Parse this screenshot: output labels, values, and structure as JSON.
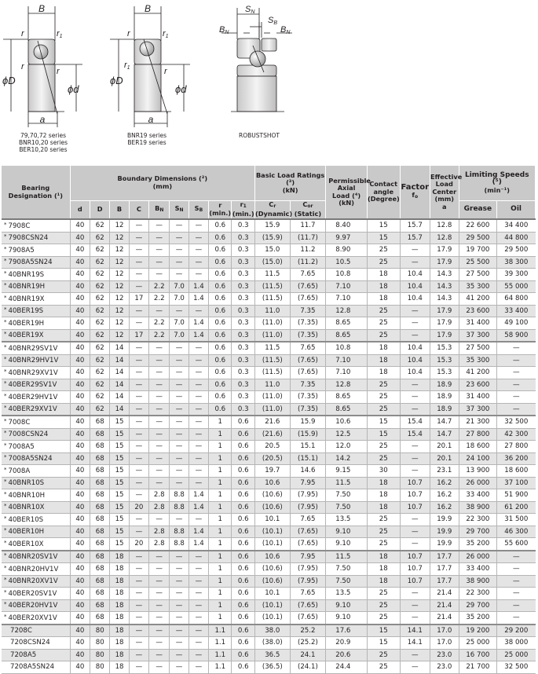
{
  "diagrams": {
    "captions": [
      [
        "79,70,72 series",
        "BNR10,20 series",
        "BER10,20 series"
      ],
      [
        "BNR19 series",
        "BER19 series"
      ],
      [
        "ROBUSTSHOT"
      ]
    ],
    "labels": {
      "B": "B",
      "r": "r",
      "r1": "r",
      "phiD": "ϕD",
      "phid": "ϕd",
      "a": "a",
      "SN": "S",
      "SB": "S",
      "BN": "B",
      "sub_N": "N",
      "sub_B": "B",
      "sub_1": "1"
    }
  },
  "table": {
    "headers": {
      "designation": "Bearing Designation (¹)",
      "boundary": "Boundary Dimensions (²)",
      "boundary_unit": "(mm)",
      "load_ratings": "Basic Load Ratings (³)",
      "load_ratings_unit": "(kN)",
      "permissible": "Permissible Axial Load (⁴)",
      "permissible_unit": "(kN)",
      "contact": "Contact angle",
      "contact_unit": "(Degree)",
      "factor": "Factor",
      "factor_sym": "f",
      "factor_sub": "o",
      "eff": "Effective Load Center",
      "eff_unit": "(mm)",
      "eff_sym": "a",
      "limiting": "Limiting Speeds (⁵)",
      "limiting_unit": "(min⁻¹)",
      "d": "d",
      "D": "D",
      "B": "B",
      "C": "C",
      "BN": "B",
      "SN": "S",
      "SB": "S",
      "N": "N",
      "Bsub": "B",
      "r": "r",
      "r1": "r",
      "r1_sub": "1",
      "min": "(min.)",
      "Cr": "C",
      "Cr_sub": "r",
      "Cr_note": "(Dynamic)",
      "Cor": "C",
      "Cor_sub": "or",
      "Cor_note": "(Static)",
      "grease": "Grease",
      "oil": "Oil"
    },
    "rows": [
      {
        "star": true,
        "des": "7908C",
        "v": [
          "40",
          "62",
          "12",
          "—",
          "—",
          "—",
          "—",
          "0.6",
          "0.3",
          "15.9",
          "11.7",
          "8.40",
          "15",
          "15.7",
          "12.8",
          "22 600",
          "34 400"
        ]
      },
      {
        "star": true,
        "des": "7908CSN24",
        "v": [
          "40",
          "62",
          "12",
          "—",
          "—",
          "—",
          "—",
          "0.6",
          "0.3",
          "(15.9)",
          "(11.7)",
          "9.97",
          "15",
          "15.7",
          "12.8",
          "29 500",
          "44 800"
        ]
      },
      {
        "star": true,
        "des": "7908A5",
        "v": [
          "40",
          "62",
          "12",
          "—",
          "—",
          "—",
          "—",
          "0.6",
          "0.3",
          "15.0",
          "11.2",
          "8.90",
          "25",
          "—",
          "17.9",
          "19 700",
          "29 500"
        ]
      },
      {
        "star": true,
        "des": "7908A5SN24",
        "v": [
          "40",
          "62",
          "12",
          "—",
          "—",
          "—",
          "—",
          "0.6",
          "0.3",
          "(15.0)",
          "(11.2)",
          "10.5",
          "25",
          "—",
          "17.9",
          "25 500",
          "38 300"
        ]
      },
      {
        "star": true,
        "des": "40BNR19S",
        "v": [
          "40",
          "62",
          "12",
          "—",
          "—",
          "—",
          "—",
          "0.6",
          "0.3",
          "11.5",
          "7.65",
          "10.8",
          "18",
          "10.4",
          "14.3",
          "27 500",
          "39 300"
        ]
      },
      {
        "star": true,
        "des": "40BNR19H",
        "v": [
          "40",
          "62",
          "12",
          "—",
          "2.2",
          "7.0",
          "1.4",
          "0.6",
          "0.3",
          "(11.5)",
          "(7.65)",
          "7.10",
          "18",
          "10.4",
          "14.3",
          "35 300",
          "55 000"
        ]
      },
      {
        "star": true,
        "des": "40BNR19X",
        "v": [
          "40",
          "62",
          "12",
          "17",
          "2.2",
          "7.0",
          "1.4",
          "0.6",
          "0.3",
          "(11.5)",
          "(7.65)",
          "7.10",
          "18",
          "10.4",
          "14.3",
          "41 200",
          "64 800"
        ]
      },
      {
        "star": true,
        "des": "40BER19S",
        "v": [
          "40",
          "62",
          "12",
          "—",
          "—",
          "—",
          "—",
          "0.6",
          "0.3",
          "11.0",
          "7.35",
          "12.8",
          "25",
          "—",
          "17.9",
          "23 600",
          "33 400"
        ]
      },
      {
        "star": true,
        "des": "40BER19H",
        "v": [
          "40",
          "62",
          "12",
          "—",
          "2.2",
          "7.0",
          "1.4",
          "0.6",
          "0.3",
          "(11.0)",
          "(7.35)",
          "8.65",
          "25",
          "—",
          "17.9",
          "31 400",
          "49 100"
        ]
      },
      {
        "star": true,
        "des": "40BER19X",
        "v": [
          "40",
          "62",
          "12",
          "17",
          "2.2",
          "7.0",
          "1.4",
          "0.6",
          "0.3",
          "(11.0)",
          "(7.35)",
          "8.65",
          "25",
          "—",
          "17.9",
          "37 300",
          "58 900"
        ]
      },
      {
        "star": true,
        "des": "40BNR29SV1V",
        "group": true,
        "v": [
          "40",
          "62",
          "14",
          "—",
          "—",
          "—",
          "—",
          "0.6",
          "0.3",
          "11.5",
          "7.65",
          "10.8",
          "18",
          "10.4",
          "15.3",
          "27 500",
          "—"
        ]
      },
      {
        "star": true,
        "des": "40BNR29HV1V",
        "v": [
          "40",
          "62",
          "14",
          "—",
          "—",
          "—",
          "—",
          "0.6",
          "0.3",
          "(11.5)",
          "(7.65)",
          "7.10",
          "18",
          "10.4",
          "15.3",
          "35 300",
          "—"
        ]
      },
      {
        "star": true,
        "des": "40BNR29XV1V",
        "v": [
          "40",
          "62",
          "14",
          "—",
          "—",
          "—",
          "—",
          "0.6",
          "0.3",
          "(11.5)",
          "(7.65)",
          "7.10",
          "18",
          "10.4",
          "15.3",
          "41 200",
          "—"
        ]
      },
      {
        "star": true,
        "des": "40BER29SV1V",
        "v": [
          "40",
          "62",
          "14",
          "—",
          "—",
          "—",
          "—",
          "0.6",
          "0.3",
          "11.0",
          "7.35",
          "12.8",
          "25",
          "—",
          "18.9",
          "23 600",
          "—"
        ]
      },
      {
        "star": true,
        "des": "40BER29HV1V",
        "v": [
          "40",
          "62",
          "14",
          "—",
          "—",
          "—",
          "—",
          "0.6",
          "0.3",
          "(11.0)",
          "(7.35)",
          "8.65",
          "25",
          "—",
          "18.9",
          "31 400",
          "—"
        ]
      },
      {
        "star": true,
        "des": "40BER29XV1V",
        "v": [
          "40",
          "62",
          "14",
          "—",
          "—",
          "—",
          "—",
          "0.6",
          "0.3",
          "(11.0)",
          "(7.35)",
          "8.65",
          "25",
          "—",
          "18.9",
          "37 300",
          "—"
        ]
      },
      {
        "star": true,
        "des": "7008C",
        "group": true,
        "v": [
          "40",
          "68",
          "15",
          "—",
          "—",
          "—",
          "—",
          "1",
          "0.6",
          "21.6",
          "15.9",
          "10.6",
          "15",
          "15.4",
          "14.7",
          "21 300",
          "32 500"
        ]
      },
      {
        "star": true,
        "des": "7008CSN24",
        "v": [
          "40",
          "68",
          "15",
          "—",
          "—",
          "—",
          "—",
          "1",
          "0.6",
          "(21.6)",
          "(15.9)",
          "12.5",
          "15",
          "15.4",
          "14.7",
          "27 800",
          "42 300"
        ]
      },
      {
        "star": true,
        "des": "7008A5",
        "v": [
          "40",
          "68",
          "15",
          "—",
          "—",
          "—",
          "—",
          "1",
          "0.6",
          "20.5",
          "15.1",
          "12.0",
          "25",
          "—",
          "20.1",
          "18 600",
          "27 800"
        ]
      },
      {
        "star": true,
        "des": "7008A5SN24",
        "v": [
          "40",
          "68",
          "15",
          "—",
          "—",
          "—",
          "—",
          "1",
          "0.6",
          "(20.5)",
          "(15.1)",
          "14.2",
          "25",
          "—",
          "20.1",
          "24 100",
          "36 200"
        ]
      },
      {
        "star": true,
        "des": "7008A",
        "v": [
          "40",
          "68",
          "15",
          "—",
          "—",
          "—",
          "—",
          "1",
          "0.6",
          "19.7",
          "14.6",
          "9.15",
          "30",
          "—",
          "23.1",
          "13 900",
          "18 600"
        ]
      },
      {
        "star": true,
        "des": "40BNR10S",
        "v": [
          "40",
          "68",
          "15",
          "—",
          "—",
          "—",
          "—",
          "1",
          "0.6",
          "10.6",
          "7.95",
          "11.5",
          "18",
          "10.7",
          "16.2",
          "26 000",
          "37 100"
        ]
      },
      {
        "star": true,
        "des": "40BNR10H",
        "v": [
          "40",
          "68",
          "15",
          "—",
          "2.8",
          "8.8",
          "1.4",
          "1",
          "0.6",
          "(10.6)",
          "(7.95)",
          "7.50",
          "18",
          "10.7",
          "16.2",
          "33 400",
          "51 900"
        ]
      },
      {
        "star": true,
        "des": "40BNR10X",
        "v": [
          "40",
          "68",
          "15",
          "20",
          "2.8",
          "8.8",
          "1.4",
          "1",
          "0.6",
          "(10.6)",
          "(7.95)",
          "7.50",
          "18",
          "10.7",
          "16.2",
          "38 900",
          "61 200"
        ]
      },
      {
        "star": true,
        "des": "40BER10S",
        "v": [
          "40",
          "68",
          "15",
          "—",
          "—",
          "—",
          "—",
          "1",
          "0.6",
          "10.1",
          "7.65",
          "13.5",
          "25",
          "—",
          "19.9",
          "22 300",
          "31 500"
        ]
      },
      {
        "star": true,
        "des": "40BER10H",
        "v": [
          "40",
          "68",
          "15",
          "—",
          "2.8",
          "8.8",
          "1.4",
          "1",
          "0.6",
          "(10.1)",
          "(7.65)",
          "9.10",
          "25",
          "—",
          "19.9",
          "29 700",
          "46 300"
        ]
      },
      {
        "star": true,
        "des": "40BER10X",
        "v": [
          "40",
          "68",
          "15",
          "20",
          "2.8",
          "8.8",
          "1.4",
          "1",
          "0.6",
          "(10.1)",
          "(7.65)",
          "9.10",
          "25",
          "—",
          "19.9",
          "35 200",
          "55 600"
        ]
      },
      {
        "star": true,
        "des": "40BNR20SV1V",
        "group": true,
        "v": [
          "40",
          "68",
          "18",
          "—",
          "—",
          "—",
          "—",
          "1",
          "0.6",
          "10.6",
          "7.95",
          "11.5",
          "18",
          "10.7",
          "17.7",
          "26 000",
          "—"
        ]
      },
      {
        "star": true,
        "des": "40BNR20HV1V",
        "v": [
          "40",
          "68",
          "18",
          "—",
          "—",
          "—",
          "—",
          "1",
          "0.6",
          "(10.6)",
          "(7.95)",
          "7.50",
          "18",
          "10.7",
          "17.7",
          "33 400",
          "—"
        ]
      },
      {
        "star": true,
        "des": "40BNR20XV1V",
        "v": [
          "40",
          "68",
          "18",
          "—",
          "—",
          "—",
          "—",
          "1",
          "0.6",
          "(10.6)",
          "(7.95)",
          "7.50",
          "18",
          "10.7",
          "17.7",
          "38 900",
          "—"
        ]
      },
      {
        "star": true,
        "des": "40BER20SV1V",
        "v": [
          "40",
          "68",
          "18",
          "—",
          "—",
          "—",
          "—",
          "1",
          "0.6",
          "10.1",
          "7.65",
          "13.5",
          "25",
          "—",
          "21.4",
          "22 300",
          "—"
        ]
      },
      {
        "star": true,
        "des": "40BER20HV1V",
        "v": [
          "40",
          "68",
          "18",
          "—",
          "—",
          "—",
          "—",
          "1",
          "0.6",
          "(10.1)",
          "(7.65)",
          "9.10",
          "25",
          "—",
          "21.4",
          "29 700",
          "—"
        ]
      },
      {
        "star": true,
        "des": "40BER20XV1V",
        "v": [
          "40",
          "68",
          "18",
          "—",
          "—",
          "—",
          "—",
          "1",
          "0.6",
          "(10.1)",
          "(7.65)",
          "9.10",
          "25",
          "—",
          "21.4",
          "35 200",
          "—"
        ]
      },
      {
        "star": false,
        "des": "7208C",
        "group": true,
        "v": [
          "40",
          "80",
          "18",
          "—",
          "—",
          "—",
          "—",
          "1.1",
          "0.6",
          "38.0",
          "25.2",
          "17.6",
          "15",
          "14.1",
          "17.0",
          "19 200",
          "29 200"
        ]
      },
      {
        "star": false,
        "des": "7208CSN24",
        "v": [
          "40",
          "80",
          "18",
          "—",
          "—",
          "—",
          "—",
          "1.1",
          "0.6",
          "(38.0)",
          "(25.2)",
          "20.9",
          "15",
          "14.1",
          "17.0",
          "25 000",
          "38 000"
        ]
      },
      {
        "star": false,
        "des": "7208A5",
        "v": [
          "40",
          "80",
          "18",
          "—",
          "—",
          "—",
          "—",
          "1.1",
          "0.6",
          "36.5",
          "24.1",
          "20.6",
          "25",
          "—",
          "23.0",
          "16 700",
          "25 000"
        ]
      },
      {
        "star": false,
        "des": "7208A5SN24",
        "v": [
          "40",
          "80",
          "18",
          "—",
          "—",
          "—",
          "—",
          "1.1",
          "0.6",
          "(36.5)",
          "(24.1)",
          "24.4",
          "25",
          "—",
          "23.0",
          "21 700",
          "32 500"
        ]
      }
    ],
    "star_symbol": "*"
  }
}
